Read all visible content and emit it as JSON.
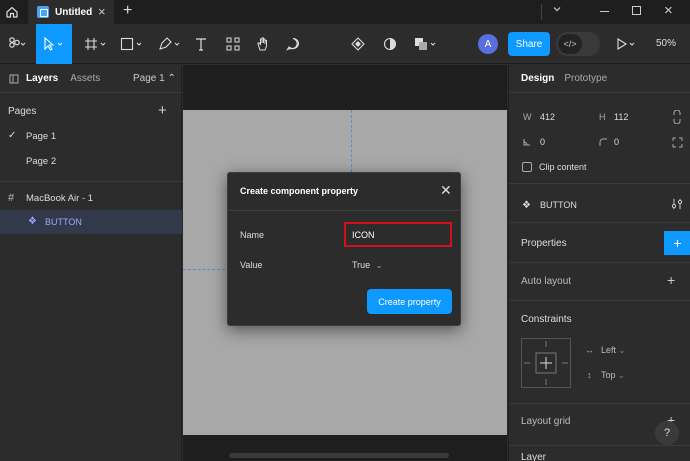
{
  "titlebar": {
    "tab_title": "Untitled",
    "tab_close": "×",
    "new_tab": "+",
    "window_close": "×"
  },
  "toolbar": {
    "share_label": "Share",
    "avatar_initial": "A",
    "zoom": "50%",
    "code_label": "</>"
  },
  "left_panel": {
    "tabs": [
      "Layers",
      "Assets"
    ],
    "page_selector": "Page 1 ⌃",
    "pages_heading": "Pages",
    "pages": [
      "Page 1",
      "Page 2"
    ],
    "frame_layer": "MacBook Air - 1",
    "component_layer": "BUTTON"
  },
  "dialog": {
    "title": "Create component property",
    "name_label": "Name",
    "name_value": "ICON",
    "value_label": "Value",
    "value_selected": "True",
    "create_button": "Create property",
    "highlight_color": "#d3111b"
  },
  "right_panel": {
    "tabs": [
      "Design",
      "Prototype"
    ],
    "w_label": "W",
    "w_value": "412",
    "h_label": "H",
    "h_value": "112",
    "x_value": "0",
    "y_value": "0",
    "clip_content": "Clip content",
    "component_name": "BUTTON",
    "properties": "Properties",
    "auto_layout": "Auto layout",
    "constraints": "Constraints",
    "constraint_h": "Left",
    "constraint_v": "Top",
    "layout_grid": "Layout grid",
    "layer": "Layer",
    "help": "?"
  },
  "colors": {
    "accent": "#0d99ff",
    "component": "#9fa6ff",
    "panel_bg": "#2c2c2c",
    "canvas_bg": "#1e1e1e"
  }
}
